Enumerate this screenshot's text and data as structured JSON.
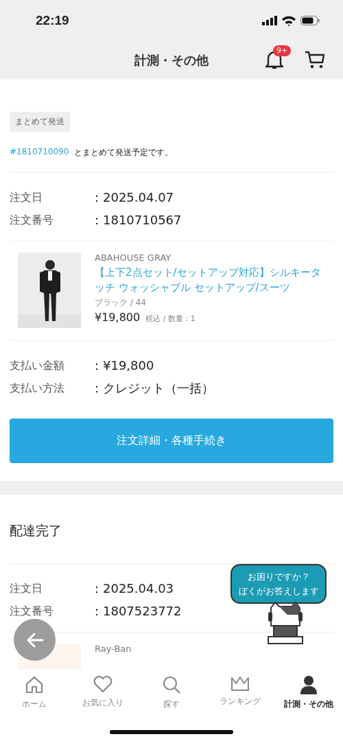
{
  "status_bar": {
    "time": "22:19"
  },
  "header": {
    "title": "計測・その他",
    "notification_badge": "9+"
  },
  "order_1": {
    "tag": "まとめて発送",
    "bundle_link": "#1810710090",
    "bundle_text": "とまとめて発送予定です。",
    "info": [
      {
        "label": "注文日",
        "value": "：2025.04.07"
      },
      {
        "label": "注文番号",
        "value": "：1810710567"
      }
    ],
    "product": {
      "brand": "ABAHOUSE GRAY",
      "name": "【上下2点セット/セットアップ対応】シルキータッチ ウォッシャブル セットアップ/スーツ",
      "variant": "ブラック / 44",
      "price": "¥19,800",
      "price_note": "税込 / 数量：1"
    },
    "payment": [
      {
        "label": "支払い金額",
        "value": "：¥19,800"
      },
      {
        "label": "支払い方法",
        "value": "：クレジット（一括）"
      }
    ],
    "button": "注文詳細・各種手続き"
  },
  "order_2": {
    "status": "配達完了",
    "info": [
      {
        "label": "注文日",
        "value": "：2025.04.03"
      },
      {
        "label": "注文番号",
        "value": "：1807523772"
      }
    ],
    "product": {
      "brand": "Ray-Ban"
    }
  },
  "help_bubble": {
    "lines": [
      "お困りですか？",
      "ぼくがお答えします"
    ]
  },
  "tab_bar": [
    {
      "kind": "home",
      "label": "ホーム",
      "selected": false
    },
    {
      "kind": "favorite",
      "label": "お気に入り",
      "selected": false
    },
    {
      "kind": "search",
      "label": "探す",
      "selected": false
    },
    {
      "kind": "ranking",
      "label": "ランキング",
      "selected": false
    },
    {
      "kind": "account",
      "label": "計測・その他",
      "selected": true
    }
  ]
}
